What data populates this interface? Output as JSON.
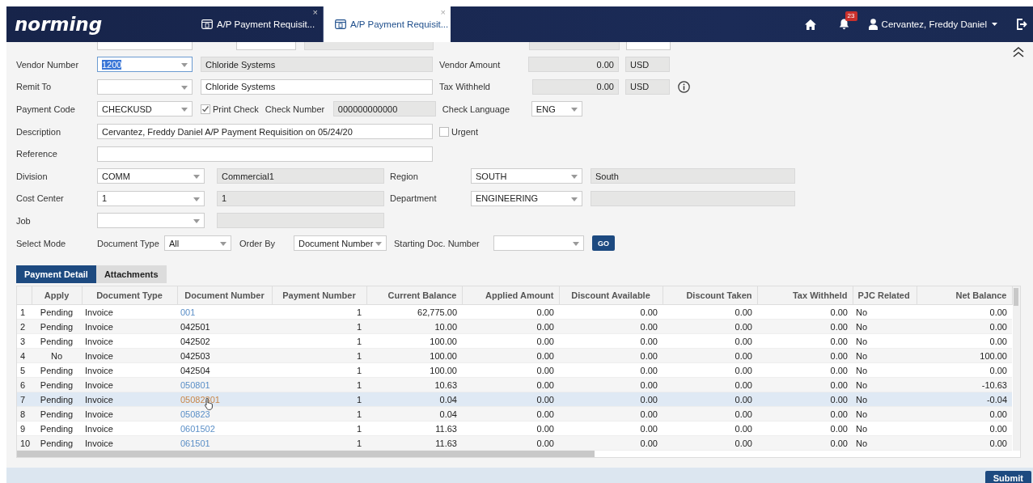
{
  "header": {
    "logo": "norming",
    "tabs": [
      {
        "label": "A/P Payment Requisit...",
        "selected": false
      },
      {
        "label": "A/P Payment Requisit...",
        "selected": true
      }
    ],
    "close_glyph": "×",
    "notifications": "23",
    "user": "Cervantez, Freddy Daniel"
  },
  "form": {
    "vendor_number": {
      "label": "Vendor Number",
      "value": "1200",
      "highlighted": true,
      "name": "Chloride Systems"
    },
    "vendor_amount": {
      "label": "Vendor Amount",
      "value": "0.00",
      "currency": "USD"
    },
    "remit_to": {
      "label": "Remit To",
      "name": "Chloride Systems"
    },
    "tax_withheld": {
      "label": "Tax Withheld",
      "value": "0.00",
      "currency": "USD"
    },
    "payment_code": {
      "label": "Payment Code",
      "value": "CHECKUSD"
    },
    "print_check": {
      "label": "Print Check",
      "checked": true
    },
    "check_number": {
      "label": "Check Number",
      "value": "000000000000"
    },
    "check_language": {
      "label": "Check Language",
      "value": "ENG"
    },
    "description": {
      "label": "Description",
      "value": "Cervantez, Freddy Daniel A/P Payment Requisition on 05/24/20"
    },
    "urgent": {
      "label": "Urgent",
      "checked": false
    },
    "reference": {
      "label": "Reference"
    },
    "division": {
      "label": "Division",
      "value": "COMM",
      "name": "Commercial1"
    },
    "region": {
      "label": "Region",
      "value": "SOUTH",
      "name": "South"
    },
    "cost_center": {
      "label": "Cost Center",
      "value": "1",
      "name": "1"
    },
    "department": {
      "label": "Department",
      "value": "ENGINEERING"
    },
    "job": {
      "label": "Job"
    },
    "select_mode": {
      "label": "Select Mode"
    },
    "document_type": {
      "label": "Document Type",
      "value": "All"
    },
    "order_by": {
      "label": "Order By",
      "value": "Document Number"
    },
    "starting_doc_number": {
      "label": "Starting Doc. Number"
    },
    "go_button": "GO"
  },
  "detail_tabs": [
    {
      "label": "Payment Detail",
      "selected": true
    },
    {
      "label": "Attachments",
      "selected": false
    }
  ],
  "table": {
    "columns": [
      "",
      "Apply",
      "Document Type",
      "Document Number",
      "Payment Number",
      "Current Balance",
      "Applied Amount",
      "Discount Available",
      "Discount Taken",
      "Tax Withheld",
      "PJC Related",
      "Net Balance"
    ],
    "rows": [
      {
        "cells": [
          "1",
          "Pending",
          "Invoice",
          "001",
          "1",
          "62,775.00",
          "0.00",
          "0.00",
          "0.00",
          "0.00",
          "No",
          "0.00"
        ],
        "link": true,
        "selected": false,
        "hovered": false
      },
      {
        "cells": [
          "2",
          "Pending",
          "Invoice",
          "042501",
          "1",
          "10.00",
          "0.00",
          "0.00",
          "0.00",
          "0.00",
          "No",
          "0.00"
        ],
        "link": false,
        "selected": false,
        "hovered": false
      },
      {
        "cells": [
          "3",
          "Pending",
          "Invoice",
          "042502",
          "1",
          "100.00",
          "0.00",
          "0.00",
          "0.00",
          "0.00",
          "No",
          "0.00"
        ],
        "link": false,
        "selected": false,
        "hovered": false
      },
      {
        "cells": [
          "4",
          "No",
          "Invoice",
          "042503",
          "1",
          "100.00",
          "0.00",
          "0.00",
          "0.00",
          "0.00",
          "No",
          "100.00"
        ],
        "link": false,
        "selected": false,
        "hovered": false
      },
      {
        "cells": [
          "5",
          "Pending",
          "Invoice",
          "042504",
          "1",
          "100.00",
          "0.00",
          "0.00",
          "0.00",
          "0.00",
          "No",
          "0.00"
        ],
        "link": false,
        "selected": false,
        "hovered": false
      },
      {
        "cells": [
          "6",
          "Pending",
          "Invoice",
          "050801",
          "1",
          "10.63",
          "0.00",
          "0.00",
          "0.00",
          "0.00",
          "No",
          "-10.63"
        ],
        "link": true,
        "selected": false,
        "hovered": false
      },
      {
        "cells": [
          "7",
          "Pending",
          "Invoice",
          "05082301",
          "1",
          "0.04",
          "0.00",
          "0.00",
          "0.00",
          "0.00",
          "No",
          "-0.04"
        ],
        "link": true,
        "selected": true,
        "hovered": true
      },
      {
        "cells": [
          "8",
          "Pending",
          "Invoice",
          "050823",
          "1",
          "0.04",
          "0.00",
          "0.00",
          "0.00",
          "0.00",
          "No",
          "0.00"
        ],
        "link": true,
        "selected": false,
        "hovered": false
      },
      {
        "cells": [
          "9",
          "Pending",
          "Invoice",
          "0601502",
          "1",
          "11.63",
          "0.00",
          "0.00",
          "0.00",
          "0.00",
          "No",
          "0.00"
        ],
        "link": true,
        "selected": false,
        "hovered": false
      },
      {
        "cells": [
          "10",
          "Pending",
          "Invoice",
          "061501",
          "1",
          "11.63",
          "0.00",
          "0.00",
          "0.00",
          "0.00",
          "No",
          "0.00"
        ],
        "link": true,
        "selected": false,
        "hovered": false
      }
    ]
  },
  "submit_button": "Submit"
}
